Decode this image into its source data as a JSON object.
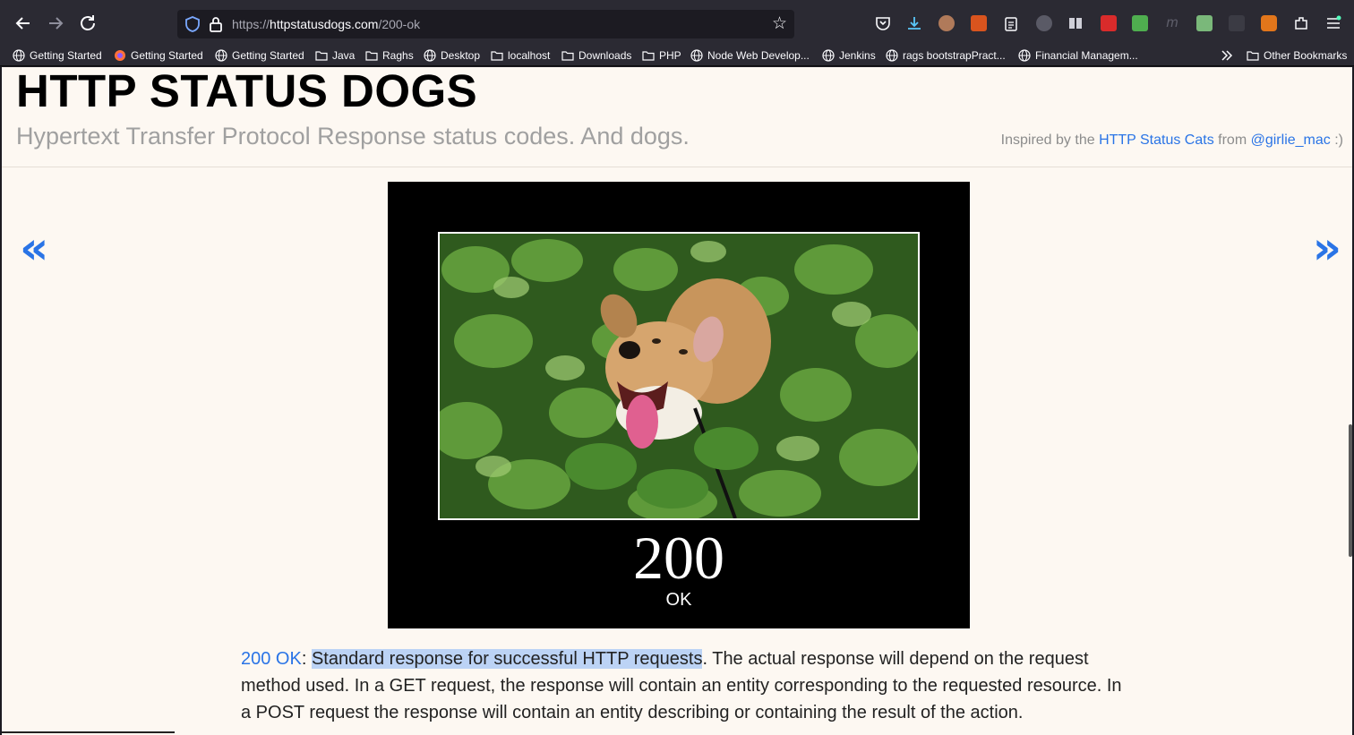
{
  "browser": {
    "url_prefix": "https://",
    "url_host": "httpstatusdogs.com",
    "url_path": "/200-ok",
    "back_icon": "arrow-left-icon",
    "forward_icon": "arrow-right-icon",
    "reload_icon": "reload-icon",
    "star_icon": "star-icon"
  },
  "bookmarks": [
    {
      "label": "Getting Started",
      "icon": "globe-icon"
    },
    {
      "label": "Getting Started",
      "icon": "firefox-icon"
    },
    {
      "label": "Getting Started",
      "icon": "globe-icon"
    },
    {
      "label": "Java",
      "icon": "folder-icon"
    },
    {
      "label": "Raghs",
      "icon": "folder-icon"
    },
    {
      "label": "Desktop",
      "icon": "globe-icon"
    },
    {
      "label": "localhost",
      "icon": "folder-icon"
    },
    {
      "label": "Downloads",
      "icon": "folder-icon"
    },
    {
      "label": "PHP",
      "icon": "folder-icon"
    },
    {
      "label": "Node Web Develop...",
      "icon": "globe-icon"
    },
    {
      "label": "Jenkins",
      "icon": "globe-icon"
    },
    {
      "label": "rags bootstrapPract...",
      "icon": "globe-icon"
    },
    {
      "label": "Financial Managem...",
      "icon": "globe-icon"
    },
    {
      "label": "Other Bookmarks",
      "icon": "folder-icon"
    }
  ],
  "page": {
    "title": "HTTP STATUS DOGS",
    "subtitle": "Hypertext Transfer Protocol Response status codes. And dogs.",
    "inspired_prefix": "Inspired by the",
    "inspired_link1": "HTTP Status Cats",
    "inspired_mid": "from",
    "inspired_link2": "@girlie_mac",
    "inspired_suffix": ":)",
    "prev_arrow": "«",
    "next_arrow": "»",
    "poster_code": "200",
    "poster_text": "OK",
    "caption_link": "200 OK",
    "caption_colon": ":",
    "caption_highlight": "Standard response for successful HTTP requests",
    "caption_rest": ". The actual response will depend on the request method used. In a GET request, the response will contain an entity corresponding to the requested resource. In a POST request the response will contain an entity describing or containing the result of the action."
  },
  "colors": {
    "link": "#2a74e6",
    "page_bg": "#fdf8f2",
    "toolbar_bg": "#2b2a33",
    "highlight": "#bcd3f5"
  }
}
